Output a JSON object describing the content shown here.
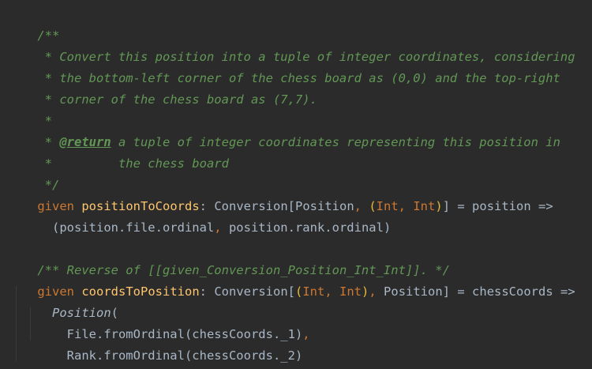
{
  "code": {
    "l1": {
      "t1": "/**"
    },
    "l2": {
      "t1": " * Convert this position into a tuple of integer coordinates, considering"
    },
    "l3": {
      "t1": " * the bottom-left corner of the chess board as (0,0) and the top-right"
    },
    "l4": {
      "t1": " * corner of the chess board as (7,7)."
    },
    "l5": {
      "t1": " *"
    },
    "l6": {
      "t1": " * ",
      "tag": "@return",
      "t2": " a tuple of integer coordinates representing this position in"
    },
    "l7": {
      "t1": " *         the chess board"
    },
    "l8": {
      "t1": " */"
    },
    "l9": {
      "kw": "given",
      "sp": " ",
      "name": "positionToCoords",
      "colon": ": ",
      "type": "Conversion",
      "lb": "[",
      "t1": "Position",
      "comma1": ", ",
      "lp": "(",
      "int1": "Int",
      "comma2": ", ",
      "int2": "Int",
      "rp": ")",
      "rb": "]",
      "rest": " = position =>"
    },
    "l10": {
      "t1": "  (position.file.ordinal",
      "comma": ",",
      "t2": " position.rank.ordinal)"
    },
    "l11": {
      "t1": ""
    },
    "l12": {
      "t1": "/** Reverse of ",
      "link": "[[given_Conversion_Position_Int_Int]]",
      "t2": ". */"
    },
    "l13": {
      "kw": "given",
      "sp": " ",
      "name": "coordsToPosition",
      "colon": ": ",
      "type": "Conversion",
      "lb": "[",
      "lp": "(",
      "int1": "Int",
      "comma1": ", ",
      "int2": "Int",
      "rp": ")",
      "comma2": ", ",
      "t1": "Position",
      "rb": "]",
      "rest": " = chessCoords =>"
    },
    "l14": {
      "t1": "  ",
      "ctor": "Position",
      "t2": "("
    },
    "l15": {
      "t1": "    File.fromOrdinal(chessCoords._1)",
      "comma": ","
    },
    "l16": {
      "t1": "    Rank.fromOrdinal(chessCoords._2)"
    },
    "l17": {
      "t1": "  )"
    }
  },
  "colors": {
    "background": "#2b2b2b",
    "keyword": "#cc7832",
    "function": "#ffc66d",
    "doc_comment": "#629755",
    "text": "#a9b7c6"
  }
}
